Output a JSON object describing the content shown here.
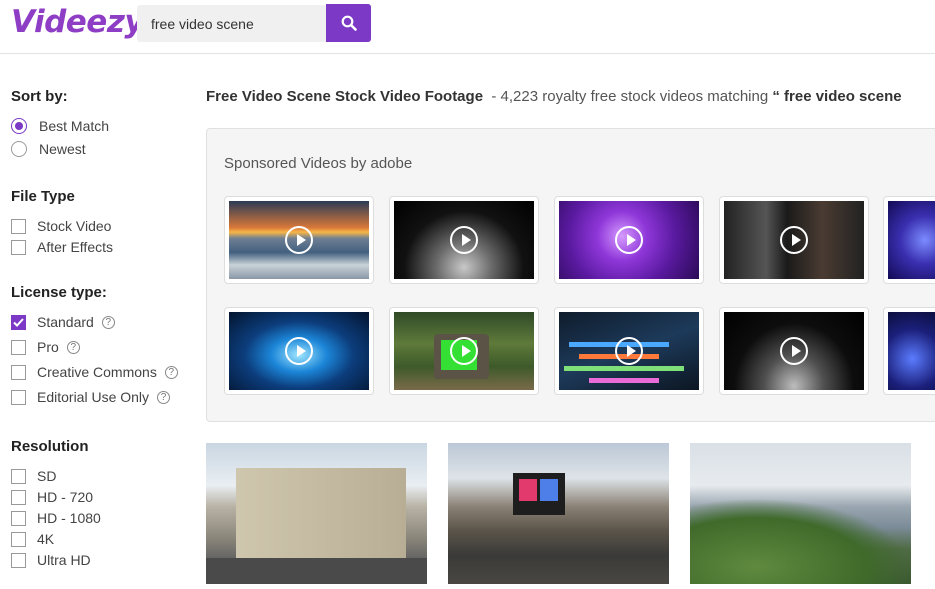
{
  "header": {
    "logo": "Videezy",
    "search_value": "free video scene"
  },
  "sidebar": {
    "sort": {
      "title": "Sort by:",
      "options": [
        {
          "label": "Best Match",
          "selected": true
        },
        {
          "label": "Newest",
          "selected": false
        }
      ]
    },
    "file_type": {
      "title": "File Type",
      "options": [
        {
          "label": "Stock Video",
          "checked": false
        },
        {
          "label": "After Effects",
          "checked": false
        }
      ]
    },
    "license": {
      "title": "License type:",
      "options": [
        {
          "label": "Standard",
          "checked": true
        },
        {
          "label": "Pro",
          "checked": false
        },
        {
          "label": "Creative Commons",
          "checked": false
        },
        {
          "label": "Editorial Use Only",
          "checked": false
        }
      ],
      "help_glyph": "?"
    },
    "resolution": {
      "title": "Resolution",
      "options": [
        {
          "label": "SD",
          "checked": false
        },
        {
          "label": "HD - 720",
          "checked": false
        },
        {
          "label": "HD - 1080",
          "checked": false
        },
        {
          "label": "4K",
          "checked": false
        },
        {
          "label": "Ultra HD",
          "checked": false
        }
      ]
    }
  },
  "results": {
    "title": "Free Video Scene Stock Video Footage",
    "count_text": "- 4,223 royalty free stock videos matching",
    "query_open": "“",
    "query": "free video scene"
  },
  "sponsored": {
    "title": "Sponsored Videos by adobe",
    "thumbnails": [
      {
        "name": "sunset-sea"
      },
      {
        "name": "smoke-dark"
      },
      {
        "name": "purple-lightning"
      },
      {
        "name": "studio-equipment"
      },
      {
        "name": "blue-neon"
      },
      {
        "name": "blue-light-burst"
      },
      {
        "name": "retro-tv-jungle"
      },
      {
        "name": "timeline-editor"
      },
      {
        "name": "dark-smoke-floor"
      },
      {
        "name": "bokeh-lights"
      }
    ]
  },
  "result_thumbnails": [
    {
      "name": "city-street-buildings"
    },
    {
      "name": "river-boat-screens"
    },
    {
      "name": "lake-trees"
    }
  ],
  "colors": {
    "accent": "#7b39c6",
    "logo": "#8e3ec5"
  }
}
